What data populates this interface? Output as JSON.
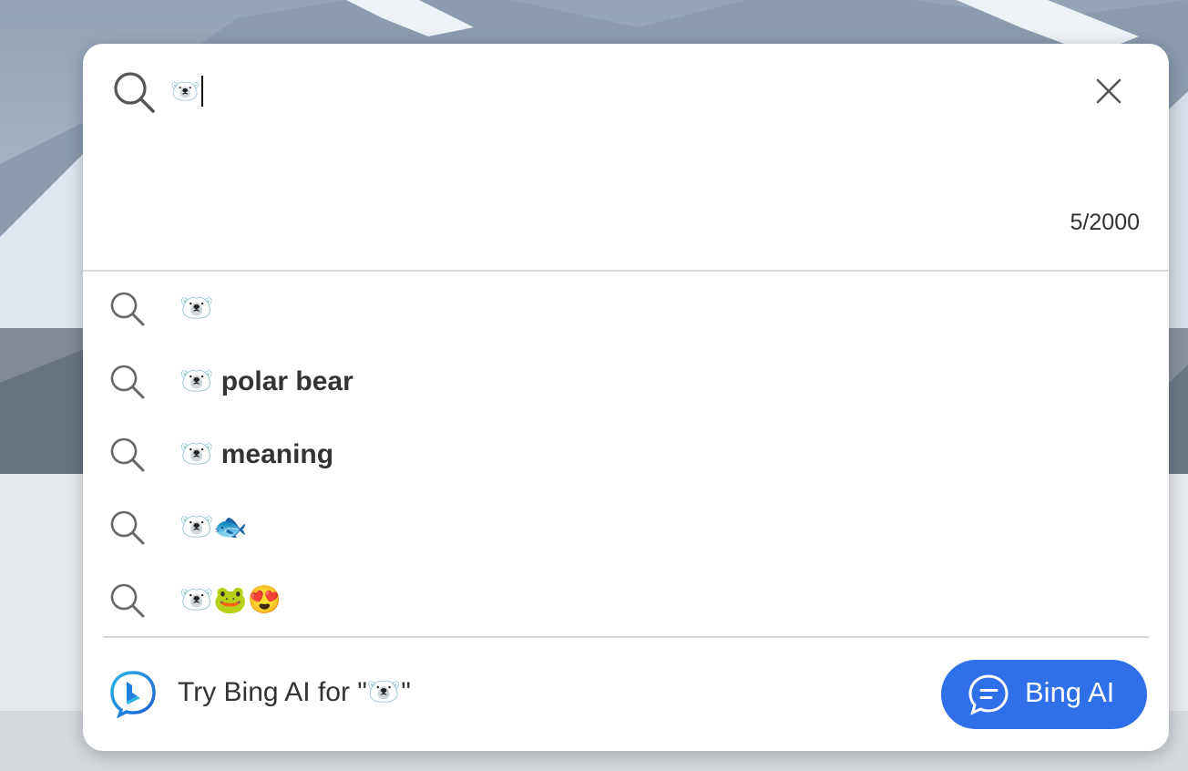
{
  "search": {
    "query": "🐻‍❄️",
    "char_count": "5/2000"
  },
  "suggestions": [
    {
      "prefix": "🐻‍❄️",
      "bold": ""
    },
    {
      "prefix": "🐻‍❄️ ",
      "bold": "polar bear"
    },
    {
      "prefix": "🐻‍❄️ ",
      "bold": "meaning"
    },
    {
      "prefix": "🐻‍❄️🐟",
      "bold": ""
    },
    {
      "prefix": "🐻‍❄️🐸😍",
      "bold": ""
    }
  ],
  "footer": {
    "try_text": "Try Bing AI for \"🐻‍❄️\"",
    "button_label": "Bing AI"
  },
  "colors": {
    "accent": "#2f6fe8",
    "panel_bg": "#ffffff",
    "text": "#333333"
  },
  "icons": [
    "search-icon",
    "close-icon",
    "bing-logo-icon",
    "chat-bubble-icon"
  ]
}
